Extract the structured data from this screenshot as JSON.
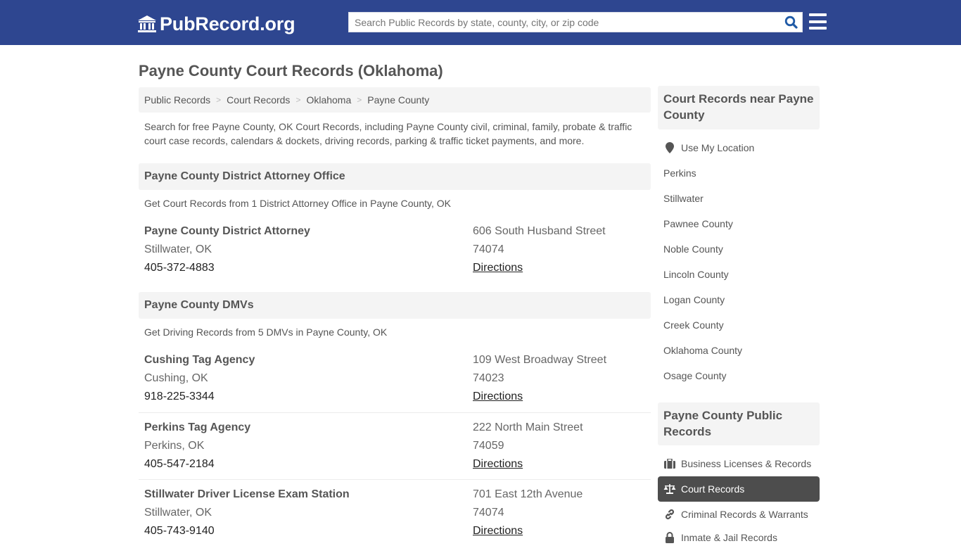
{
  "header": {
    "logo_text": "PubRecord.org",
    "search_placeholder": "Search Public Records by state, county, city, or zip code",
    "colors": {
      "brand": "#2e4690",
      "search_icon": "#1f5aa6"
    }
  },
  "page": {
    "title": "Payne County Court Records (Oklahoma)",
    "breadcrumb": [
      "Public Records",
      "Court Records",
      "Oklahoma",
      "Payne County"
    ],
    "intro": "Search for free Payne County, OK Court Records, including Payne County civil, criminal, family, probate & traffic court case records, calendars & dockets, driving records, parking & traffic ticket payments, and more."
  },
  "sections": [
    {
      "title": "Payne County District Attorney Office",
      "subtitle": "Get Court Records from 1 District Attorney Office in Payne County, OK",
      "entries": [
        {
          "name": "Payne County District Attorney",
          "city": "Stillwater, OK",
          "phone": "405-372-4883",
          "address": "606 South Husband Street",
          "zip": "74074",
          "directions": "Directions"
        }
      ]
    },
    {
      "title": "Payne County DMVs",
      "subtitle": "Get Driving Records from 5 DMVs in Payne County, OK",
      "entries": [
        {
          "name": "Cushing Tag Agency",
          "city": "Cushing, OK",
          "phone": "918-225-3344",
          "address": "109 West Broadway Street",
          "zip": "74023",
          "directions": "Directions"
        },
        {
          "name": "Perkins Tag Agency",
          "city": "Perkins, OK",
          "phone": "405-547-2184",
          "address": "222 North Main Street",
          "zip": "74059",
          "directions": "Directions"
        },
        {
          "name": "Stillwater Driver License Exam Station",
          "city": "Stillwater, OK",
          "phone": "405-743-9140",
          "address": "701 East 12th Avenue",
          "zip": "74074",
          "directions": "Directions"
        }
      ]
    }
  ],
  "sidebar": {
    "nearby": {
      "title": "Court Records near Payne County",
      "use_location": "Use My Location",
      "items": [
        "Perkins",
        "Stillwater",
        "Pawnee County",
        "Noble County",
        "Lincoln County",
        "Logan County",
        "Creek County",
        "Oklahoma County",
        "Osage County"
      ]
    },
    "public_records": {
      "title": "Payne County Public Records",
      "items": [
        {
          "label": "Business Licenses & Records",
          "icon": "briefcase-icon",
          "active": false
        },
        {
          "label": "Court Records",
          "icon": "scale-icon",
          "active": true
        },
        {
          "label": "Criminal Records & Warrants",
          "icon": "link-icon",
          "active": false
        },
        {
          "label": "Inmate & Jail Records",
          "icon": "lock-icon",
          "active": false
        }
      ]
    }
  }
}
